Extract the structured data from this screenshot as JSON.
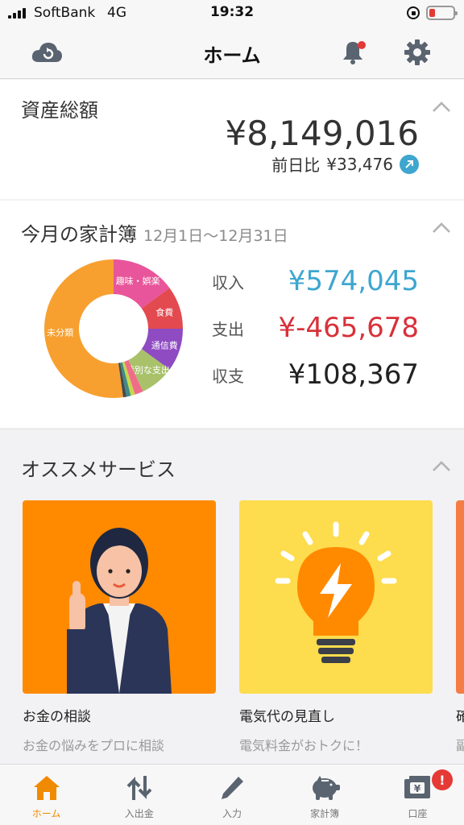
{
  "status_bar": {
    "carrier": "SoftBank",
    "network": "4G",
    "time": "19:32"
  },
  "nav": {
    "title": "ホーム"
  },
  "assets": {
    "title": "資産総額",
    "amount": "¥8,149,016",
    "diff_label": "前日比",
    "diff_value": "¥33,476"
  },
  "budget": {
    "title": "今月の家計簿",
    "range": "12月1日〜12月31日",
    "income_label": "収入",
    "income_value": "¥574,045",
    "expense_label": "支出",
    "expense_value": "¥-465,678",
    "balance_label": "収支",
    "balance_value": "¥108,367"
  },
  "chart_data": {
    "type": "pie",
    "slices": [
      {
        "label": "趣味・娯楽",
        "value": 15,
        "color": "#e8559a"
      },
      {
        "label": "食費",
        "value": 10,
        "color": "#e24a4f"
      },
      {
        "label": "通信費",
        "value": 10,
        "color": "#8e4bc2"
      },
      {
        "label": "特別な支出",
        "value": 8,
        "color": "#a9c26a"
      },
      {
        "label": "",
        "value": 2,
        "color": "#f06d8a"
      },
      {
        "label": "",
        "value": 1,
        "color": "#c6d84a"
      },
      {
        "label": "",
        "value": 1,
        "color": "#3f8a8a"
      },
      {
        "label": "",
        "value": 0.8,
        "color": "#4a4a4a"
      },
      {
        "label": "未分類",
        "value": 52.2,
        "color": "#f7a030"
      }
    ]
  },
  "services": {
    "title": "オススメサービス",
    "items": [
      {
        "name": "お金の相談",
        "desc": "お金の悩みをプロに相談"
      },
      {
        "name": "電気代の見直し",
        "desc": "電気料金がおトクに！"
      },
      {
        "name": "確",
        "desc": "副"
      }
    ]
  },
  "tabs": [
    {
      "label": "ホーム"
    },
    {
      "label": "入出金"
    },
    {
      "label": "入力"
    },
    {
      "label": "家計簿"
    },
    {
      "label": "口座",
      "badge": "!"
    }
  ],
  "colors": {
    "accent": "#f08a00",
    "income": "#3ea6cf",
    "expense": "#d8313a",
    "bell_dot": "#e53935"
  }
}
